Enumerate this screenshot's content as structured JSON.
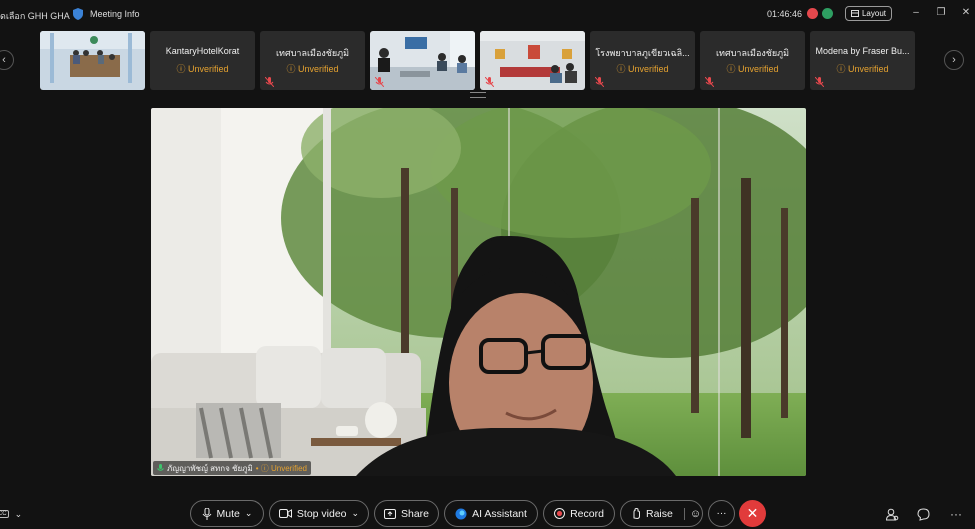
{
  "titlebar": {
    "app_title": "ัดเลือก GHH GHA",
    "meeting_info": "Meeting Info",
    "clock": "01:46:46",
    "layout_label": "Layout"
  },
  "filmstrip": {
    "tiles": [
      {
        "type": "video"
      },
      {
        "type": "name",
        "name": "KantaryHotelKorat",
        "status": "Unverified",
        "muted": false
      },
      {
        "type": "name",
        "name": "เทศบาลเมืองชัยภูมิ",
        "status": "Unverified",
        "muted": true
      },
      {
        "type": "video",
        "muted": true
      },
      {
        "type": "video",
        "muted": true
      },
      {
        "type": "name",
        "name": "โรงพยาบาลภูเขียวเฉลิ...",
        "status": "Unverified",
        "muted": true
      },
      {
        "type": "name",
        "name": "เทศบาลเมืองชัยภูมิ",
        "status": "Unverified",
        "muted": true
      },
      {
        "type": "name",
        "name": "Modena by Fraser Bu...",
        "status": "Unverified",
        "muted": true
      }
    ]
  },
  "main_video": {
    "speaker_name": "ภัญญาพัชญ์ สทกจ ชัยภูมิ",
    "speaker_status": "Unverified"
  },
  "controls": {
    "mute": "Mute",
    "stop_video": "Stop video",
    "share": "Share",
    "ai_assistant": "AI Assistant",
    "record": "Record",
    "raise": "Raise",
    "more": "···",
    "leave": "✕"
  },
  "colors": {
    "background": "#121212",
    "unverified": "#e5a230",
    "end_call": "#e13b3b",
    "record": "#e5484d"
  }
}
